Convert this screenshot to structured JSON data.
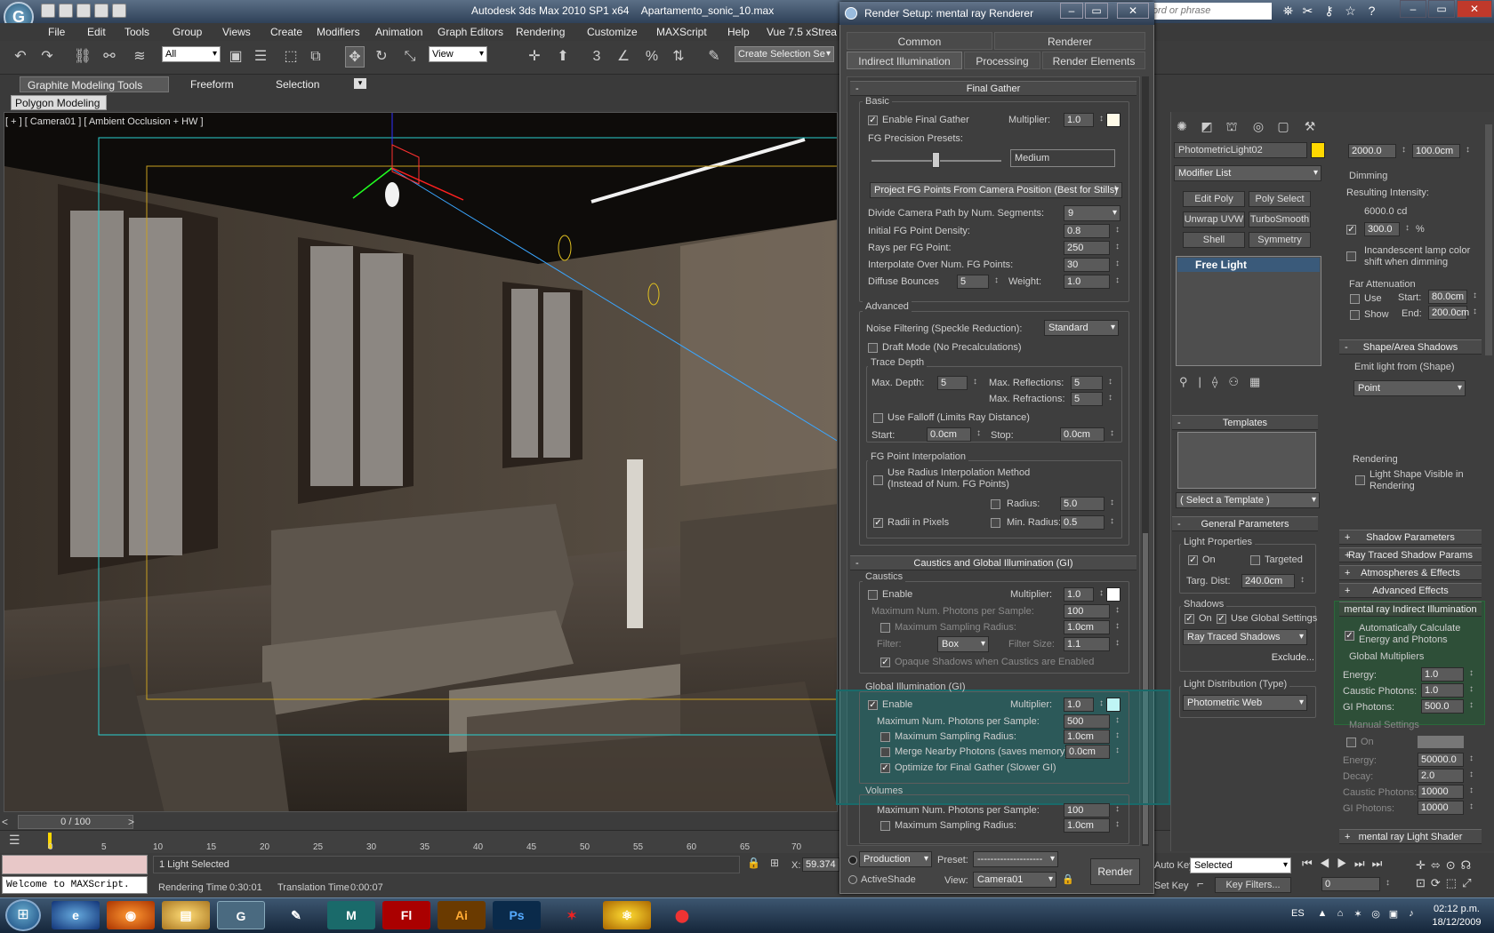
{
  "app": {
    "title": "Autodesk 3ds Max  2010 SP1 x64",
    "file": "Apartamento_sonic_10.max",
    "search_placeholder": "word or phrase"
  },
  "menu": [
    "File",
    "Edit",
    "Tools",
    "Group",
    "Views",
    "Create",
    "Modifiers",
    "Animation",
    "Graph Editors",
    "Rendering",
    "Customize",
    "MAXScript",
    "Help",
    "Vue 7.5 xStrea"
  ],
  "toolbar": {
    "selection_filter": "All",
    "ref_coord": "View",
    "named_selection": "Create Selection Se"
  },
  "ribbon": {
    "tabs": [
      "Graphite Modeling Tools",
      "Freeform",
      "Selection"
    ],
    "panel": "Polygon Modeling"
  },
  "viewport": {
    "label": "[ + ] [ Camera01 ] [ Ambient Occlusion + HW ]"
  },
  "timeline": {
    "slider": "0 / 100",
    "ticks": [
      "0",
      "5",
      "10",
      "15",
      "20",
      "25",
      "30",
      "35",
      "40",
      "45",
      "50",
      "55",
      "60",
      "65",
      "70"
    ]
  },
  "status": {
    "selection": "1 Light Selected",
    "rendering_time_label": "Rendering Time",
    "rendering_time": "0:30:01",
    "translation_time_label": "Translation Time",
    "translation_time": "0:00:07",
    "x_label": "X:",
    "x_value": "59.374",
    "maxscript": "Welcome to MAXScript."
  },
  "render_setup": {
    "title": "Render Setup: mental ray Renderer",
    "tabs_row1": [
      "Common",
      "Renderer"
    ],
    "tabs_row2": [
      "Indirect Illumination",
      "Processing",
      "Render Elements"
    ],
    "final_gather": {
      "header": "Final Gather",
      "basic_label": "Basic",
      "enable_fg": "Enable Final Gather",
      "multiplier_label": "Multiplier:",
      "multiplier": "1.0",
      "presets_label": "FG Precision Presets:",
      "preset_value": "Medium",
      "project_mode": "Project FG Points From Camera Position (Best for Stills)",
      "divide_label": "Divide Camera Path by Num. Segments:",
      "divide_value": "9",
      "density_label": "Initial FG Point Density:",
      "density_value": "0.8",
      "rays_label": "Rays per FG Point:",
      "rays_value": "250",
      "interp_label": "Interpolate Over Num. FG Points:",
      "interp_value": "30",
      "bounces_label": "Diffuse Bounces",
      "bounces_value": "5",
      "weight_label": "Weight:",
      "weight_value": "1.0",
      "advanced_label": "Advanced",
      "noise_label": "Noise Filtering (Speckle Reduction):",
      "noise_value": "Standard",
      "draft_mode": "Draft Mode (No Precalculations)",
      "trace_depth_label": "Trace Depth",
      "max_depth_label": "Max. Depth:",
      "max_depth": "5",
      "max_refl_label": "Max. Reflections:",
      "max_refl": "5",
      "max_refr_label": "Max. Refractions:",
      "max_refr": "5",
      "use_falloff": "Use Falloff (Limits Ray Distance)",
      "start_label": "Start:",
      "start_value": "0.0cm",
      "stop_label": "Stop:",
      "stop_value": "0.0cm",
      "interp_group": "FG Point Interpolation",
      "radius_method_1": "Use Radius Interpolation Method",
      "radius_method_2": "(Instead of Num. FG Points)",
      "radius_label": "Radius:",
      "radius_value": "5.0",
      "radii_pixels": "Radii in Pixels",
      "min_radius_label": "Min. Radius:",
      "min_radius_value": "0.5"
    },
    "caustics_gi": {
      "header": "Caustics and Global Illumination (GI)",
      "caustics_label": "Caustics",
      "enable": "Enable",
      "multiplier_label": "Multiplier:",
      "multiplier": "1.0",
      "max_photons_label": "Maximum Num. Photons per Sample:",
      "max_photons": "100",
      "max_radius_label": "Maximum Sampling Radius:",
      "max_radius": "1.0cm",
      "filter_label": "Filter:",
      "filter_value": "Box",
      "filter_size_label": "Filter Size:",
      "filter_size": "1.1",
      "opaque_shadows": "Opaque Shadows when Caustics are Enabled",
      "gi_label": "Global Illumination (GI)",
      "gi_enable": "Enable",
      "gi_multiplier": "1.0",
      "gi_max_photons_label": "Maximum Num. Photons per Sample:",
      "gi_max_photons": "500",
      "gi_max_radius_label": "Maximum Sampling Radius:",
      "gi_max_radius": "1.0cm",
      "merge_label": "Merge Nearby Photons (saves memory):",
      "merge_value": "0.0cm",
      "optimize": "Optimize for Final Gather (Slower GI)",
      "volumes_label": "Volumes",
      "vol_max_photons": "100",
      "vol_max_radius": "1.0cm"
    },
    "footer": {
      "mode": "Production",
      "activeshade": "ActiveShade",
      "preset_label": "Preset:",
      "preset_value": "--------------------",
      "view_label": "View:",
      "view_value": "Camera01",
      "render": "Render"
    }
  },
  "command_panel": {
    "object_name": "PhotometricLight02",
    "modifier_list": "Modifier List",
    "modifier_buttons": [
      "Edit Poly",
      "Poly Select",
      "Unwrap UVW",
      "TurboSmooth",
      "Shell",
      "Symmetry"
    ],
    "stack_item": "Free Light",
    "templates_header": "Templates",
    "template_select": "( Select a Template )",
    "general_header": "General Parameters",
    "light_props_label": "Light Properties",
    "on": "On",
    "targeted": "Targeted",
    "targ_dist_label": "Targ. Dist:",
    "targ_dist": "240.0cm",
    "shadows_label": "Shadows",
    "use_global": "Use Global Settings",
    "shadow_type": "Ray Traced Shadows",
    "exclude": "Exclude...",
    "distribution_label": "Light Distribution (Type)",
    "distribution": "Photometric Web",
    "top_values": [
      "2000.0",
      "100.0cm"
    ],
    "dimming_label": "Dimming",
    "resulting_intensity": "Resulting Intensity:",
    "intensity_value": "6000.0 cd",
    "dim_percent": "300.0",
    "percent_sign": "%",
    "incandescent_1": "Incandescent lamp color",
    "incandescent_2": "shift when dimming",
    "far_atten_label": "Far Attenuation",
    "use": "Use",
    "show": "Show",
    "start_label": "Start:",
    "start_value": "80.0cm",
    "end_label": "End:",
    "end_value": "200.0cm",
    "shape_header": "Shape/Area Shadows",
    "emit_label": "Emit light from (Shape)",
    "emit_value": "Point",
    "rendering_label": "Rendering",
    "shape_visible_1": "Light Shape Visible in",
    "shape_visible_2": "Rendering",
    "rollouts": [
      "Shadow Parameters",
      "Ray Traced Shadow Params",
      "Atmospheres & Effects",
      "Advanced Effects"
    ],
    "mr_indirect_header": "mental ray Indirect Illumination",
    "auto_calc_1": "Automatically Calculate",
    "auto_calc_2": "Energy and Photons",
    "global_mult_label": "Global Multipliers",
    "energy_label": "Energy:",
    "energy": "1.0",
    "caustic_label": "Caustic Photons:",
    "caustic": "1.0",
    "gi_photons_label": "GI Photons:",
    "gi_photons": "500.0",
    "manual_label": "Manual Settings",
    "manual_on": "On",
    "m_energy": "50000.0",
    "decay_label": "Decay:",
    "m_decay": "2.0",
    "m_caustic": "10000",
    "m_gi": "10000",
    "mr_shader": "mental ray Light Shader"
  },
  "animation": {
    "auto_key": "Auto Key",
    "set_key": "Set Key",
    "selected": "Selected",
    "key_filters": "Key Filters...",
    "frame": "0"
  },
  "taskbar": {
    "lang": "ES",
    "time": "02:12 p.m.",
    "date": "18/12/2009",
    "apps": [
      "Fl",
      "Ai",
      "Ps"
    ]
  },
  "colors": {
    "gi_highlight": "#00a0a0",
    "accent_yellow": "#ffd800",
    "gi_swatch": "#bff5f5",
    "title_blue": "#2f4158"
  }
}
